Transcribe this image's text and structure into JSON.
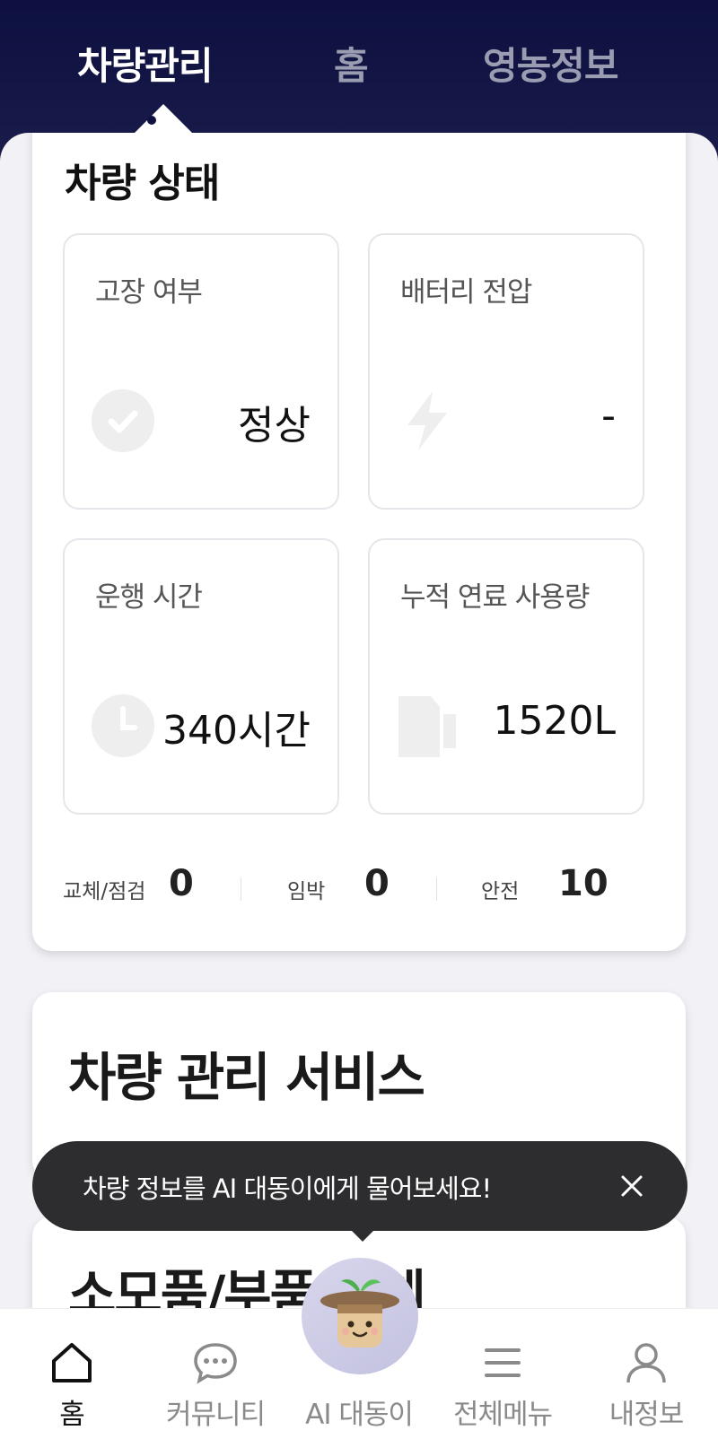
{
  "header": {
    "tabs": [
      {
        "label": "차량관리",
        "active": true
      },
      {
        "label": "홈",
        "active": false
      },
      {
        "label": "영농정보",
        "active": false
      }
    ]
  },
  "vehicle_status": {
    "title": "차량 상태",
    "tiles": [
      {
        "label": "고장 여부",
        "value": "정상",
        "icon": "check-circle-icon"
      },
      {
        "label": "배터리 전압",
        "value": "-",
        "icon": "lightning-icon"
      },
      {
        "label": "운행 시간",
        "value": "340시간",
        "icon": "clock-icon"
      },
      {
        "label": "누적 연료 사용량",
        "value": "1520L",
        "icon": "fuel-pump-icon"
      }
    ],
    "counts": [
      {
        "label": "교체/점검",
        "value": "0"
      },
      {
        "label": "임박",
        "value": "0"
      },
      {
        "label": "안전",
        "value": "10"
      }
    ]
  },
  "services": {
    "title": "차량 관리 서비스",
    "next_title": "소모품/부품 교체"
  },
  "tooltip": {
    "text": "차량 정보를 AI 대동이에게 물어보세요!"
  },
  "bottom_nav": {
    "items": [
      {
        "label": "홈",
        "icon": "home-icon",
        "active": true
      },
      {
        "label": "커뮤니티",
        "icon": "chat-bubble-icon",
        "active": false
      },
      {
        "label": "AI 대동이",
        "icon": "ai-mascot-icon",
        "active": false
      },
      {
        "label": "전체메뉴",
        "icon": "menu-icon",
        "active": false
      },
      {
        "label": "내정보",
        "icon": "user-icon",
        "active": false
      }
    ]
  },
  "colors": {
    "header_bg": "#0d1040",
    "tab_inactive": "#9a9cb1",
    "tooltip_bg": "#2d2d2f",
    "icon_gray": "#eeeeee"
  }
}
